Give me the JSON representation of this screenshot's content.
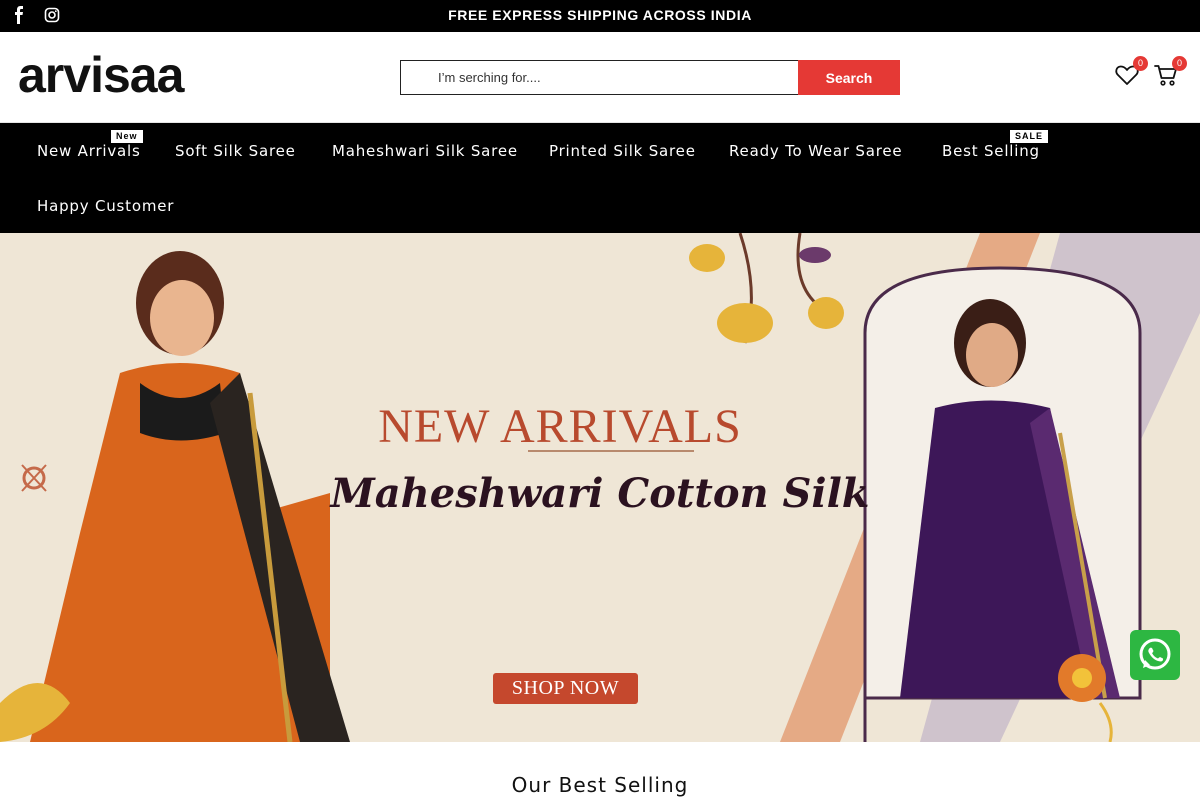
{
  "topbar": {
    "announcement": "FREE EXPRESS SHIPPING ACROSS INDIA",
    "social_icons": [
      "facebook-icon",
      "instagram-icon"
    ]
  },
  "header": {
    "logo_text": "arvisaa",
    "search": {
      "placeholder": "I’m serching for....",
      "value": "",
      "button_label": "Search"
    },
    "wishlist_count": "0",
    "cart_count": "0"
  },
  "nav": {
    "items": [
      {
        "label": "New Arrivals",
        "tag": "New"
      },
      {
        "label": "Soft Silk Saree"
      },
      {
        "label": "Maheshwari Silk Saree"
      },
      {
        "label": "Printed Silk Saree"
      },
      {
        "label": "Ready To Wear Saree"
      },
      {
        "label": "Best Selling",
        "tag": "SALE"
      },
      {
        "label": "Happy Customer"
      }
    ]
  },
  "hero": {
    "title": "NEW ARRIVALS",
    "subtitle": "Maheshwari Cotton Silk",
    "cta_label": "SHOP NOW"
  },
  "section": {
    "title": "Our Best Selling"
  },
  "colors": {
    "accent": "#e53935",
    "topbar_bg": "#000000",
    "nav_bg": "#000000",
    "hero_bg": "#efe6d6",
    "hero_title": "#b84a2e",
    "cta_bg": "#c5482d",
    "whatsapp": "#2db742"
  }
}
